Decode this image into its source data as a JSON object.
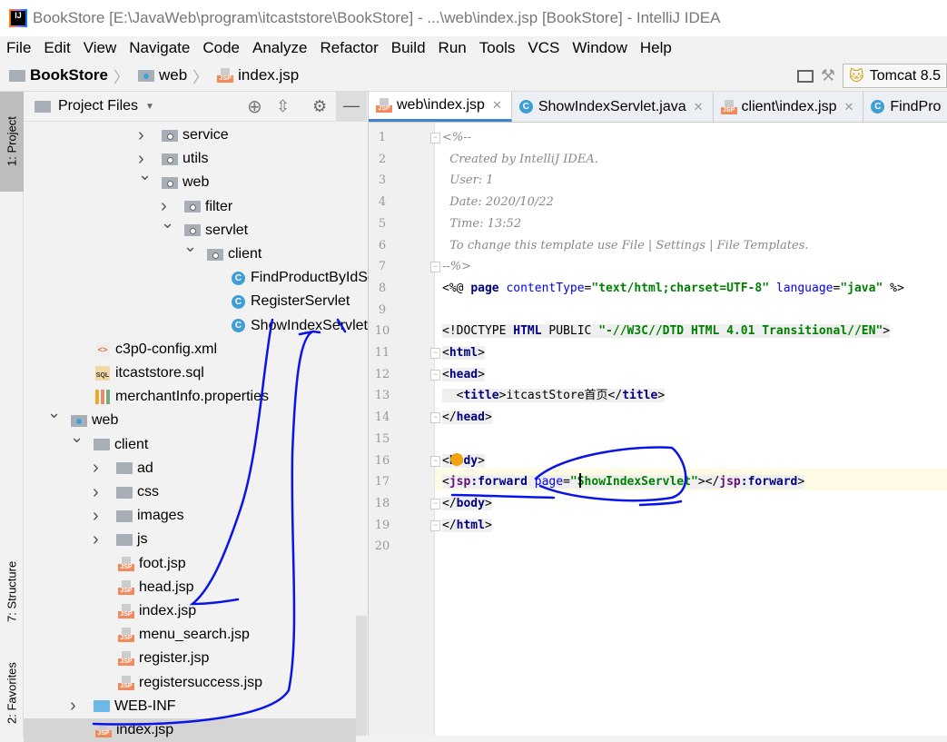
{
  "window": {
    "title": "BookStore [E:\\JavaWeb\\program\\itcaststore\\BookStore] - ...\\web\\index.jsp [BookStore] - IntelliJ IDEA",
    "logo": "IJ"
  },
  "menu": [
    "File",
    "Edit",
    "View",
    "Navigate",
    "Code",
    "Analyze",
    "Refactor",
    "Build",
    "Run",
    "Tools",
    "VCS",
    "Window",
    "Help"
  ],
  "breadcrumb": [
    "BookStore",
    "web",
    "index.jsp"
  ],
  "run_config": "Tomcat 8.5",
  "left_strip": {
    "project": "1: Project",
    "structure": "7: Structure",
    "favorites": "2: Favorites"
  },
  "panel": {
    "title": "Project Files",
    "icons": [
      "locate-icon",
      "collapse-all-icon",
      "gear-icon",
      "hide-icon"
    ]
  },
  "tree": [
    {
      "label": "service",
      "level": 5,
      "type": "pkg",
      "arrow": "right"
    },
    {
      "label": "utils",
      "level": 5,
      "type": "pkg",
      "arrow": "right"
    },
    {
      "label": "web",
      "level": 5,
      "type": "pkg",
      "arrow": "down"
    },
    {
      "label": "filter",
      "level": 6,
      "type": "pkg",
      "arrow": "right"
    },
    {
      "label": "servlet",
      "level": 6,
      "type": "pkg",
      "arrow": "down"
    },
    {
      "label": "client",
      "level": 7,
      "type": "pkg",
      "arrow": "down"
    },
    {
      "label": "FindProductByIdServlet",
      "level": 8,
      "type": "class"
    },
    {
      "label": "RegisterServlet",
      "level": 8,
      "type": "class"
    },
    {
      "label": "ShowIndexServlet",
      "level": 8,
      "type": "class"
    },
    {
      "label": "c3p0-config.xml",
      "level": 2,
      "type": "xml"
    },
    {
      "label": "itcaststore.sql",
      "level": 2,
      "type": "sql"
    },
    {
      "label": "merchantInfo.properties",
      "level": 2,
      "type": "prop"
    },
    {
      "label": "web",
      "level": 1,
      "type": "web",
      "arrow": "down"
    },
    {
      "label": "client",
      "level": 2,
      "type": "folder",
      "arrow": "down"
    },
    {
      "label": "ad",
      "level": 3,
      "type": "folder",
      "arrow": "right"
    },
    {
      "label": "css",
      "level": 3,
      "type": "folder",
      "arrow": "right"
    },
    {
      "label": "images",
      "level": 3,
      "type": "folder",
      "arrow": "right"
    },
    {
      "label": "js",
      "level": 3,
      "type": "folder",
      "arrow": "right"
    },
    {
      "label": "foot.jsp",
      "level": 3,
      "type": "jsp"
    },
    {
      "label": "head.jsp",
      "level": 3,
      "type": "jsp"
    },
    {
      "label": "index.jsp",
      "level": 3,
      "type": "jsp"
    },
    {
      "label": "menu_search.jsp",
      "level": 3,
      "type": "jsp"
    },
    {
      "label": "register.jsp",
      "level": 3,
      "type": "jsp"
    },
    {
      "label": "registersuccess.jsp",
      "level": 3,
      "type": "jsp"
    },
    {
      "label": "WEB-INF",
      "level": 2,
      "type": "blue",
      "arrow": "right"
    },
    {
      "label": "index.jsp",
      "level": 2,
      "type": "jsp",
      "selected": true
    }
  ],
  "tabs": [
    {
      "label": "web\\index.jsp",
      "icon": "jsp",
      "active": true
    },
    {
      "label": "ShowIndexServlet.java",
      "icon": "class"
    },
    {
      "label": "client\\index.jsp",
      "icon": "jsp"
    },
    {
      "label": "FindPro",
      "icon": "class"
    }
  ],
  "code": [
    [
      [
        "cm",
        "<%--"
      ]
    ],
    [
      [
        "cm",
        "  Created by IntelliJ IDEA."
      ]
    ],
    [
      [
        "cm",
        "  User: 1"
      ]
    ],
    [
      [
        "cm",
        "  Date: 2020/10/22"
      ]
    ],
    [
      [
        "cm",
        "  Time: 13:52"
      ]
    ],
    [
      [
        "cm",
        "  To change this template use File | Settings | File Templates."
      ]
    ],
    [
      [
        "cm",
        "--%>"
      ]
    ],
    [
      [
        "",
        "<%@ "
      ],
      [
        "kw",
        "page "
      ],
      [
        "attr",
        "contentType"
      ],
      [
        "",
        "="
      ],
      [
        "str",
        "\"text/html;charset=UTF-8\""
      ],
      [
        "attr",
        " language"
      ],
      [
        "",
        "="
      ],
      [
        "str",
        "\"java\""
      ],
      [
        "",
        " %>"
      ]
    ],
    [],
    [
      [
        "",
        "<!DOCTYPE "
      ],
      [
        "kw",
        "HTML"
      ],
      [
        "",
        " PUBLIC "
      ],
      [
        "str",
        "\"-//W3C//DTD HTML 4.01 Transitional//EN\""
      ],
      [
        "",
        ">"
      ]
    ],
    [
      [
        "",
        "<"
      ],
      [
        "tag",
        "html"
      ],
      [
        "",
        ">"
      ]
    ],
    [
      [
        "",
        "<"
      ],
      [
        "tag",
        "head"
      ],
      [
        "",
        ">"
      ]
    ],
    [
      [
        "",
        "  <"
      ],
      [
        "tag",
        "title"
      ],
      [
        "",
        ">itcastStore首页</"
      ],
      [
        "tag",
        "title"
      ],
      [
        "",
        ">"
      ]
    ],
    [
      [
        "",
        "</"
      ],
      [
        "tag",
        "head"
      ],
      [
        "",
        ">"
      ]
    ],
    [],
    [
      [
        "",
        "<"
      ],
      [
        "tag",
        "body"
      ],
      [
        "",
        ">"
      ]
    ],
    [
      [
        "",
        "<"
      ],
      [
        "ns",
        "jsp"
      ],
      [
        "tag",
        ":forward"
      ],
      [
        "attr",
        " page"
      ],
      [
        "",
        "="
      ],
      [
        "str",
        "\"ShowIndexServlet\""
      ],
      [
        "",
        "></"
      ],
      [
        "ns",
        "jsp"
      ],
      [
        "tag",
        ":forward"
      ],
      [
        "",
        ">"
      ]
    ],
    [
      [
        "",
        "</"
      ],
      [
        "tag",
        "body"
      ],
      [
        "",
        ">"
      ]
    ],
    [
      [
        "",
        "</"
      ],
      [
        "tag",
        "html"
      ],
      [
        "",
        ">"
      ]
    ],
    []
  ],
  "colors": {
    "ink": "#0a14e6",
    "accent": "#4083c9"
  }
}
